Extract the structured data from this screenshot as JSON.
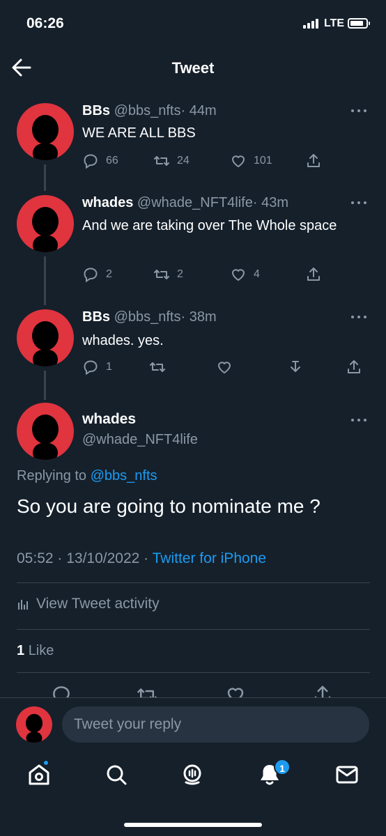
{
  "status_bar": {
    "time": "06:26",
    "network": "LTE"
  },
  "header": {
    "title": "Tweet"
  },
  "thread": [
    {
      "name": "BBs",
      "handle": "@bbs_nfts",
      "time": "· 44m",
      "text": "WE ARE ALL BBS",
      "replies": "66",
      "retweets": "24",
      "likes": "101"
    },
    {
      "name": "whades",
      "handle": "@whade_NFT4life",
      "time": "· 43m",
      "text": "And we are taking over The Whole space",
      "replies": "2",
      "retweets": "2",
      "likes": "4"
    },
    {
      "name": "BBs",
      "handle": "@bbs_nfts",
      "time": "· 38m",
      "text": "whades. yes.",
      "replies": "1",
      "retweets": "",
      "likes": ""
    }
  ],
  "focused": {
    "name": "whades",
    "handle": "@whade_NFT4life",
    "replying_prefix": "Replying to",
    "replying_to": "@bbs_nfts",
    "text": "So you are going to nominate me ?",
    "timestamp": "05:52 · 13/10/2022 ·",
    "source": "Twitter for iPhone",
    "activity_label": "View Tweet activity",
    "like_count": "1",
    "like_label": "Like"
  },
  "reply_bar": {
    "placeholder": "Tweet your reply"
  },
  "tabbar": {
    "notifications_badge": "1"
  },
  "colors": {
    "background": "#15202b",
    "accent": "#1d9bf0",
    "muted": "#8b98a5",
    "avatar": "#e0343f"
  }
}
